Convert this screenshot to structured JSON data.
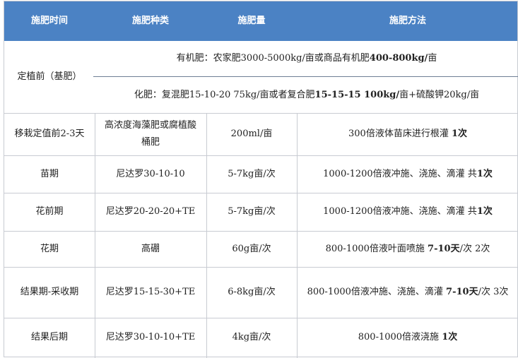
{
  "headers": [
    "施肥时间",
    "施肥种类",
    "施肥量",
    "施肥方法"
  ],
  "base": {
    "time": "定植前（基肥）",
    "organic": {
      "prefix": "有机肥：农家肥3000-5000kg/亩或商品有机肥",
      "amount": "400-800kg/",
      "unit": "亩"
    },
    "chemical": {
      "prefix": "化肥：复混肥15-10-20  75kg/亩或者复合肥",
      "amount": "15-15-15 100kg/",
      "suffix": "亩+硫酸钾20kg/亩"
    }
  },
  "rows": [
    {
      "time": "移栽定值前2-3天",
      "type": "高浓度海藻肥或腐植酸桶肥",
      "amount": "200ml/亩",
      "method": "300倍液体苗床进行根灌 ",
      "method_bold": "1次",
      "method_tail": ""
    },
    {
      "time": "苗期",
      "type": "尼达罗30-10-10",
      "amount": "5-7kg亩/次",
      "method": "1000-1200倍液冲施、浇施、滴灌 共",
      "method_bold": "1次",
      "method_tail": ""
    },
    {
      "time": "花前期",
      "type": "尼达罗20-20-20+TE",
      "amount": "5-7kg亩/次",
      "method": "1000-1200倍液冲施、浇施、滴灌 共",
      "method_bold": "1次",
      "method_tail": ""
    },
    {
      "time": "花期",
      "type": "高硼",
      "amount": "60g亩/次",
      "method": "800-1000倍液叶面喷施 ",
      "method_bold": "7-10天",
      "method_tail": "/次 2次"
    },
    {
      "time": "结果期-采收期",
      "type": "尼达罗15-15-30+TE",
      "amount": "6-8kg亩/次",
      "method": "800-1000倍液冲施、浇施、滴灌 ",
      "method_bold": "7-10天",
      "method_tail": "/次 3次"
    },
    {
      "time": "结果后期",
      "type": "尼达罗30-10-10+TE",
      "amount": "4kg亩/次",
      "method": "800-1000倍液浇施 ",
      "method_bold": "1次",
      "method_tail": ""
    }
  ]
}
